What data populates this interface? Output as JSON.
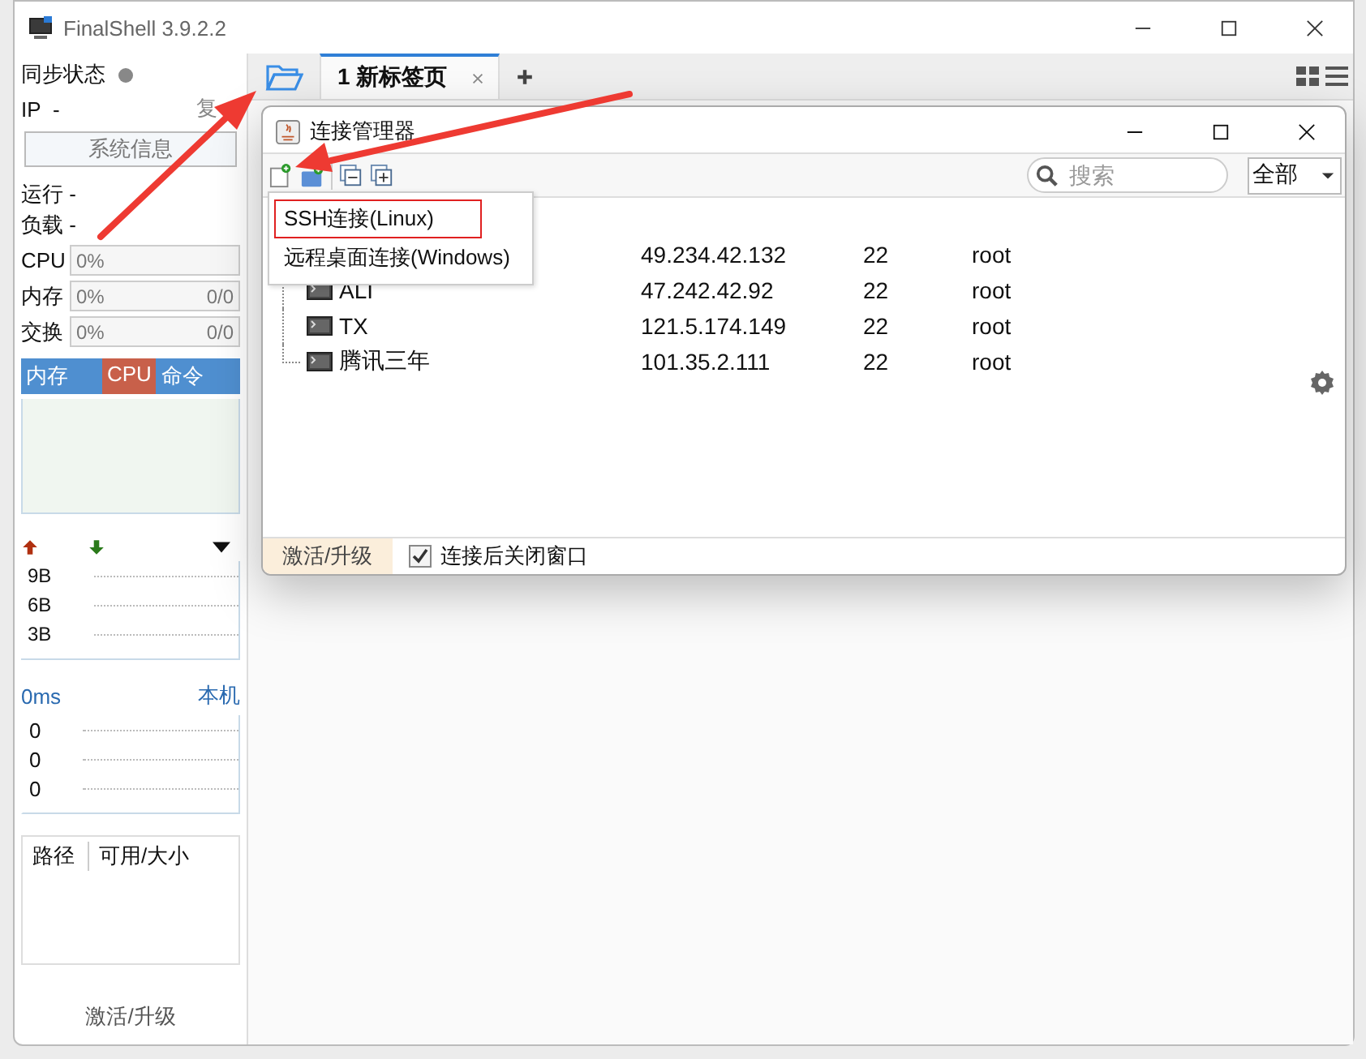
{
  "window": {
    "title": "FinalShell 3.9.2.2"
  },
  "sidebar": {
    "sync_label": "同步状态",
    "ip_label": "IP",
    "ip_value": "-",
    "copy_link": "复",
    "sysinfo_button": "系统信息",
    "stats": [
      "运行 -",
      "负载 -"
    ],
    "meters": [
      {
        "label": "CPU",
        "percent": "0%"
      },
      {
        "label": "内存",
        "percent": "0%",
        "amount": "0/0"
      },
      {
        "label": "交换",
        "percent": "0%",
        "amount": "0/0"
      }
    ],
    "process_tabs": [
      {
        "label": "内存",
        "selected": false
      },
      {
        "label": "CPU",
        "selected": true
      },
      {
        "label": "命令",
        "selected": false
      }
    ],
    "net_y_labels": [
      "9B",
      "6B",
      "3B"
    ],
    "ping": {
      "latency": "0ms",
      "target": "本机",
      "values": [
        "0",
        "0",
        "0"
      ]
    },
    "disk_columns": [
      "路径",
      "可用/大小"
    ],
    "activate_link": "激活/升级"
  },
  "tabs": [
    {
      "label": "1 新标签页",
      "selected": true
    }
  ],
  "connection_manager": {
    "title": "连接管理器",
    "search": {
      "placeholder": "搜索"
    },
    "filter": "全部",
    "rows": [
      {
        "ip": "49.234.42.132",
        "port": "22",
        "user": "root"
      },
      {
        "name": "ALI",
        "ip": "47.242.42.92",
        "port": "22",
        "user": "root"
      },
      {
        "name": "TX",
        "ip": "121.5.174.149",
        "port": "22",
        "user": "root"
      },
      {
        "name": "腾讯三年",
        "ip": "101.35.2.111",
        "port": "22",
        "user": "root"
      }
    ],
    "footer": {
      "activate": "激活/升级",
      "close_after_connect": {
        "label": "连接后关闭窗口",
        "checked": true
      }
    }
  },
  "new_menu": {
    "items": [
      {
        "label": "SSH连接(Linux)",
        "selected": true
      },
      {
        "label": "远程桌面连接(Windows)",
        "selected": false
      }
    ]
  }
}
